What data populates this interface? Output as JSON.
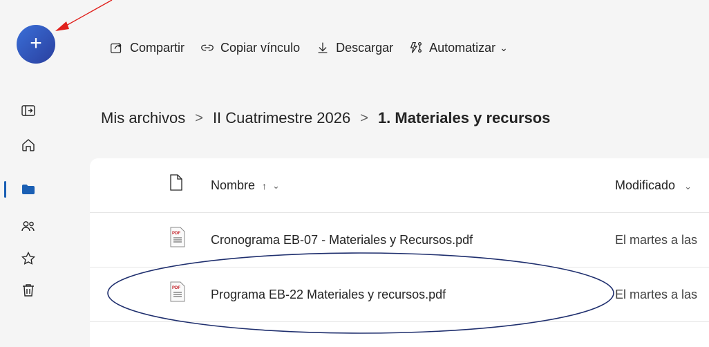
{
  "new_button": {
    "label": "+"
  },
  "sidebar": {
    "items": [
      {
        "name": "collapse-pane-icon"
      },
      {
        "name": "home-icon"
      },
      {
        "name": "folder-icon",
        "active": true
      },
      {
        "name": "people-icon"
      },
      {
        "name": "star-icon"
      },
      {
        "name": "trash-icon"
      }
    ]
  },
  "toolbar": {
    "share": "Compartir",
    "copy_link": "Copiar vínculo",
    "download": "Descargar",
    "automate": "Automatizar"
  },
  "breadcrumb": {
    "root": "Mis archivos",
    "sep1": ">",
    "middle": "II Cuatrimestre 2026",
    "sep2": ">",
    "current": "1. Materiales y recursos"
  },
  "list": {
    "header": {
      "name": "Nombre",
      "sort": "↑",
      "name_chevron": "⌄",
      "modified": "Modificado",
      "modified_chevron": "⌄"
    },
    "rows": [
      {
        "icon_label": "PDF",
        "name": "Cronograma EB-07 - Materiales y Recursos.pdf",
        "modified": "El martes a las"
      },
      {
        "icon_label": "PDF",
        "name": "Programa EB-22 Materiales y recursos.pdf",
        "modified": "El martes a las"
      }
    ]
  },
  "colors": {
    "accent": "#1a5fb4",
    "new_button": "#2f4fb8",
    "annotation_arrow": "#e0201c",
    "annotation_ellipse": "#1f2f6e",
    "pdf_red": "#c4262e"
  }
}
